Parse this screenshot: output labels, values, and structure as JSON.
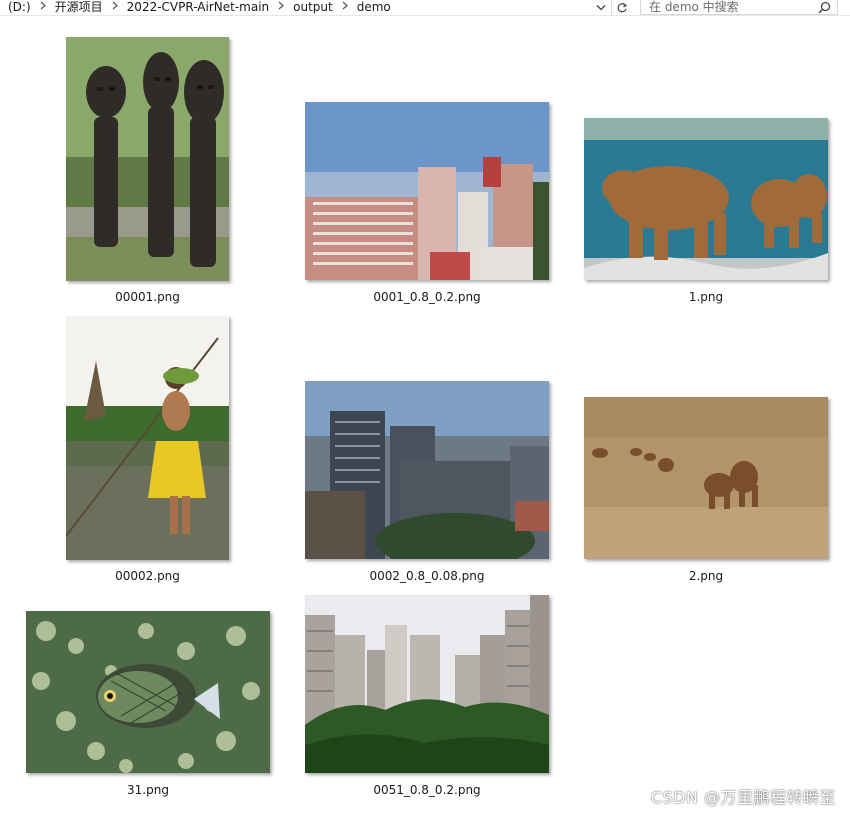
{
  "address_bar": {
    "crumbs": [
      "(D:)",
      "开源项目",
      "2022-CVPR-AirNet-main",
      "output",
      "demo"
    ]
  },
  "search": {
    "placeholder": "在 demo 中搜索"
  },
  "files": [
    {
      "name": "00001.png",
      "subject": "carved wooden totems"
    },
    {
      "name": "0001_0.8_0.2.png",
      "subject": "city buildings"
    },
    {
      "name": "1.png",
      "subject": "bears at river"
    },
    {
      "name": "00002.png",
      "subject": "woman with pole on water"
    },
    {
      "name": "0002_0.8_0.08.png",
      "subject": "city buildings"
    },
    {
      "name": "2.png",
      "subject": "lions in grassland"
    },
    {
      "name": "31.png",
      "subject": "fish in coral"
    },
    {
      "name": "0051_0.8_0.2.png",
      "subject": "apartment towers and trees"
    }
  ],
  "watermark": "CSDN @万里鹏程转瞬至",
  "colors": {
    "window_bg": "#ffffff",
    "border": "#d9d9d9",
    "text": "#1a1a1a"
  }
}
